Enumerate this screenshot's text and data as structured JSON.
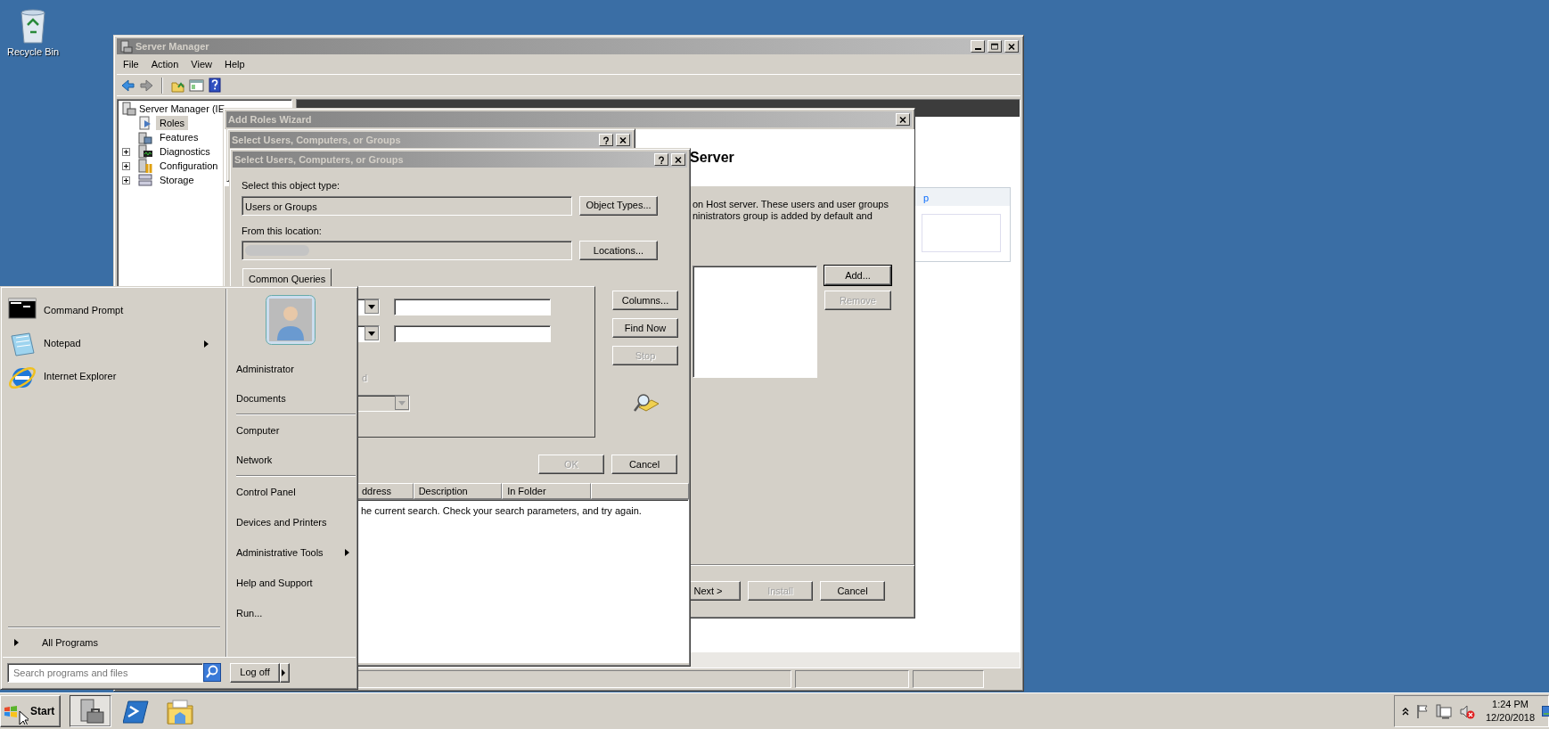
{
  "desktop": {
    "icons": [
      {
        "label": "Recycle Bin"
      }
    ]
  },
  "server_manager": {
    "title": "Server Manager",
    "menu": [
      "File",
      "Action",
      "View",
      "Help"
    ],
    "tree": {
      "label": "Server Manager (IE",
      "children": [
        {
          "label": "Roles",
          "kind": "leaf",
          "selected": true
        },
        {
          "label": "Features",
          "kind": "leaf",
          "selected": false
        },
        {
          "label": "Diagnostics",
          "kind": "collapsed",
          "selected": false
        },
        {
          "label": "Configuration",
          "kind": "collapsed",
          "selected": false
        },
        {
          "label": "Storage",
          "kind": "collapsed",
          "selected": false
        }
      ]
    },
    "pane_link": "p"
  },
  "wizard": {
    "title": "Add Roles Wizard",
    "heading": "Server",
    "description": [
      "on Host server. These users and user groups",
      "ninistrators group is added by default and"
    ],
    "side_buttons": [
      {
        "label": "Add...",
        "disabled": false,
        "default": true
      },
      {
        "label": "Remove",
        "disabled": true,
        "default": false
      }
    ],
    "nav_buttons": [
      {
        "label": "Next >",
        "disabled": false
      },
      {
        "label": "Install",
        "disabled": true
      },
      {
        "label": "Cancel",
        "disabled": false
      }
    ]
  },
  "select_dialog_back": {
    "title": "Select Users, Computers, or Groups"
  },
  "select_dialog": {
    "title": "Select Users, Computers, or Groups",
    "object_type_label": "Select this object type:",
    "object_type": "Users or Groups",
    "object_types_button": "Object Types...",
    "location_label": "From this location:",
    "locations_button": "Locations...",
    "tabs": [
      {
        "label": "Common Queries",
        "selected": true
      }
    ],
    "query_fragment": "d",
    "side_buttons": [
      {
        "label": "Columns...",
        "disabled": false
      },
      {
        "label": "Find Now",
        "disabled": false
      },
      {
        "label": "Stop",
        "disabled": true
      }
    ],
    "buttons": [
      {
        "label": "OK",
        "disabled": true
      },
      {
        "label": "Cancel",
        "disabled": false
      }
    ],
    "results": {
      "columns": [
        "ddress",
        "Description",
        "In Folder"
      ],
      "message": "he current search. Check your search parameters, and try again."
    }
  },
  "start_menu": {
    "pinned": [
      {
        "label": "Command Prompt",
        "submenu": false
      },
      {
        "label": "Notepad",
        "submenu": true
      },
      {
        "label": "Internet Explorer",
        "submenu": false
      }
    ],
    "all_programs": "All Programs",
    "search": {
      "placeholder": "Search programs and files"
    },
    "places": [
      {
        "label": "Administrator",
        "submenu": false,
        "separator_after": false
      },
      {
        "label": "Documents",
        "submenu": false,
        "separator_after": true
      },
      {
        "label": "Computer",
        "submenu": false,
        "separator_after": false
      },
      {
        "label": "Network",
        "submenu": false,
        "separator_after": true
      },
      {
        "label": "Control Panel",
        "submenu": false,
        "separator_after": false
      },
      {
        "label": "Devices and Printers",
        "submenu": false,
        "separator_after": false
      },
      {
        "label": "Administrative Tools",
        "submenu": true,
        "separator_after": false
      },
      {
        "label": "Help and Support",
        "submenu": false,
        "separator_after": false
      },
      {
        "label": "Run...",
        "submenu": false,
        "separator_after": false
      }
    ],
    "log_off": "Log off"
  },
  "taskbar": {
    "start": "Start",
    "clock": {
      "time": "1:24 PM",
      "date": "12/20/2018"
    }
  }
}
